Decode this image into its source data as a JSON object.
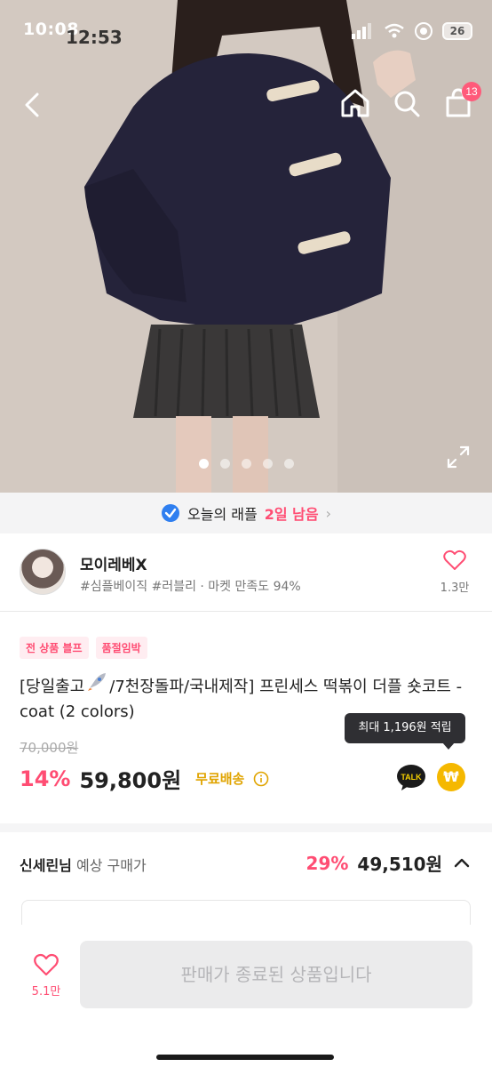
{
  "status_bar": {
    "time": "10:08",
    "time_ghost": "12:53",
    "battery": "26"
  },
  "hero": {
    "image_dots": 5,
    "active_dot": 0,
    "cart_count": "13"
  },
  "raffle": {
    "label": "오늘의 래플",
    "remaining": "2일 남음"
  },
  "seller": {
    "name": "모이레베X",
    "sub": "#심플베이직 #러블리 · 마켓 만족도 94%",
    "likes": "1.3만"
  },
  "product": {
    "tags": [
      "전 상품 블프",
      "품절임박"
    ],
    "title_pre": "[당일출고",
    "title_post": "/7천장돌파/국내제작] 프린세스 떡볶이 더플 숏코트 - coat (2 colors)",
    "tooltip": "최대 1,196원 적립",
    "original_price": "70,000원",
    "discount": "14%",
    "price": "59,800원",
    "shipping": "무료배송",
    "talk_label": "TALK",
    "won_symbol": "₩"
  },
  "expected": {
    "user": "신세린님",
    "label": "예상 구매가",
    "discount": "29%",
    "price": "49,510원"
  },
  "bottom": {
    "likes": "5.1만",
    "sold_out_label": "판매가 종료된 상품입니다"
  },
  "colors": {
    "accent": "#ff4d73",
    "shipping": "#e0a400",
    "won": "#f5b800"
  }
}
